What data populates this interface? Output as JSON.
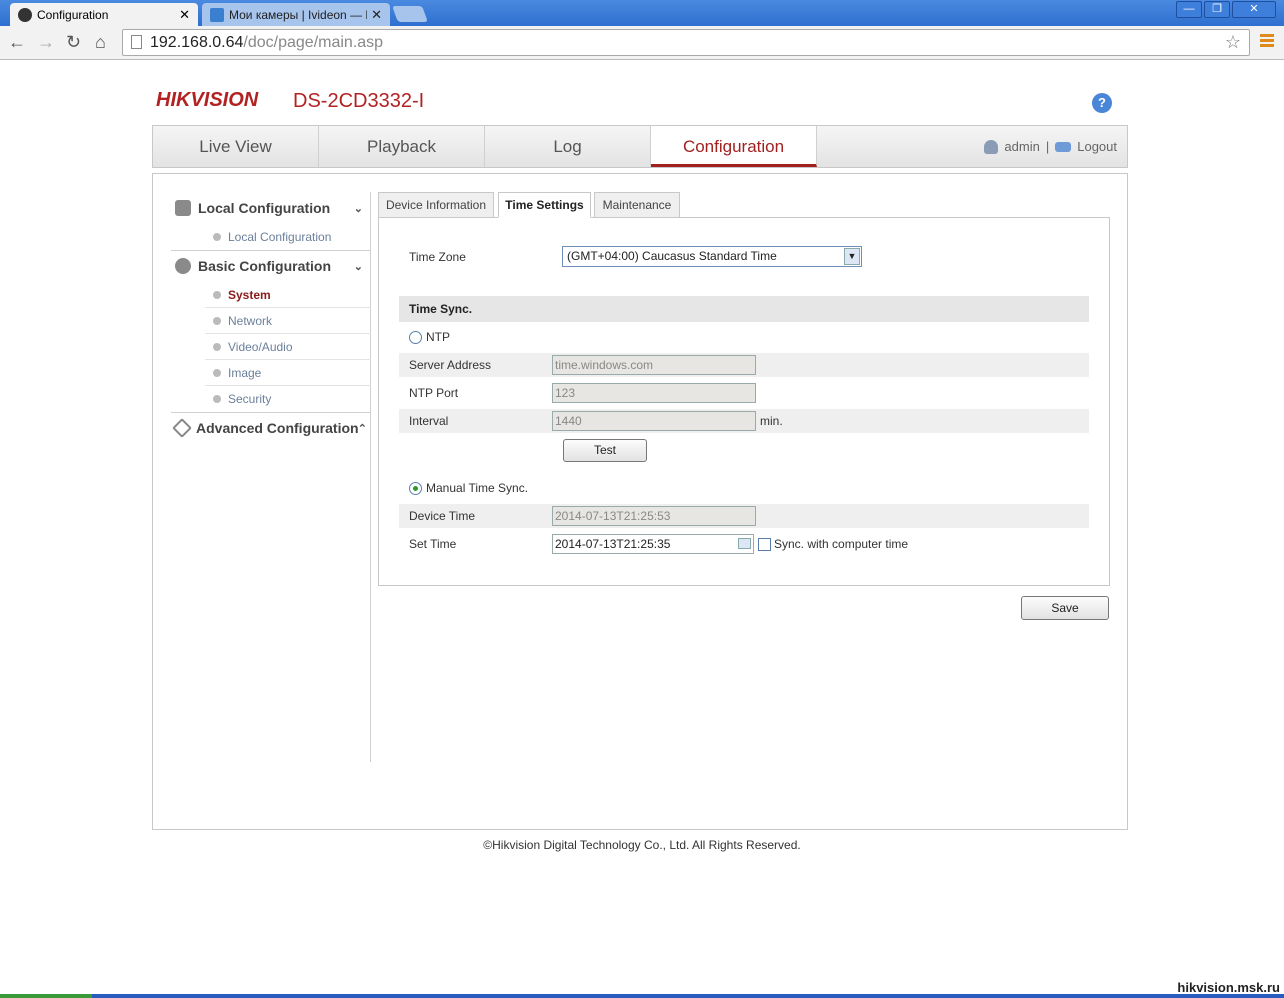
{
  "browser": {
    "tabs": [
      {
        "title": "Configuration",
        "icon": "camera-favicon",
        "active": true
      },
      {
        "title": "Мои камеры | Ivideon — Ви",
        "icon": "ivideon-favicon",
        "active": false
      }
    ],
    "url_host": "192.168.0.64",
    "url_path": "/doc/page/main.asp",
    "window_buttons": [
      "—",
      "❐",
      "✕"
    ]
  },
  "header": {
    "logo": "HIKVISION",
    "model": "DS-2CD3332-I",
    "help": "?"
  },
  "mainnav": {
    "items": [
      "Live View",
      "Playback",
      "Log",
      "Configuration"
    ],
    "active": "Configuration",
    "user": "admin",
    "separator": "|",
    "logout": "Logout"
  },
  "sidebar": {
    "local": {
      "title": "Local Configuration",
      "items": [
        "Local Configuration"
      ]
    },
    "basic": {
      "title": "Basic Configuration",
      "items": [
        "System",
        "Network",
        "Video/Audio",
        "Image",
        "Security"
      ],
      "active": "System"
    },
    "advanced": {
      "title": "Advanced Configuration"
    }
  },
  "tabs": {
    "items": [
      "Device Information",
      "Time Settings",
      "Maintenance"
    ],
    "active": "Time Settings"
  },
  "time": {
    "timezone_label": "Time Zone",
    "timezone_value": "(GMT+04:00) Caucasus Standard Time",
    "sync_title": "Time Sync.",
    "ntp_label": "NTP",
    "server_label": "Server Address",
    "server_value": "time.windows.com",
    "port_label": "NTP Port",
    "port_value": "123",
    "interval_label": "Interval",
    "interval_value": "1440",
    "interval_unit": "min.",
    "test_button": "Test",
    "manual_label": "Manual Time Sync.",
    "device_time_label": "Device Time",
    "device_time_value": "2014-07-13T21:25:53",
    "set_time_label": "Set Time",
    "set_time_value": "2014-07-13T21:25:35",
    "sync_computer_label": "Sync. with computer time",
    "save_button": "Save"
  },
  "footer": {
    "copyright": "©Hikvision Digital Technology Co., Ltd. All Rights Reserved."
  },
  "watermark": "hikvision.msk.ru",
  "colors": {
    "brand": "#b22222",
    "active_nav": "#a32020",
    "link": "#6b7f9a"
  }
}
